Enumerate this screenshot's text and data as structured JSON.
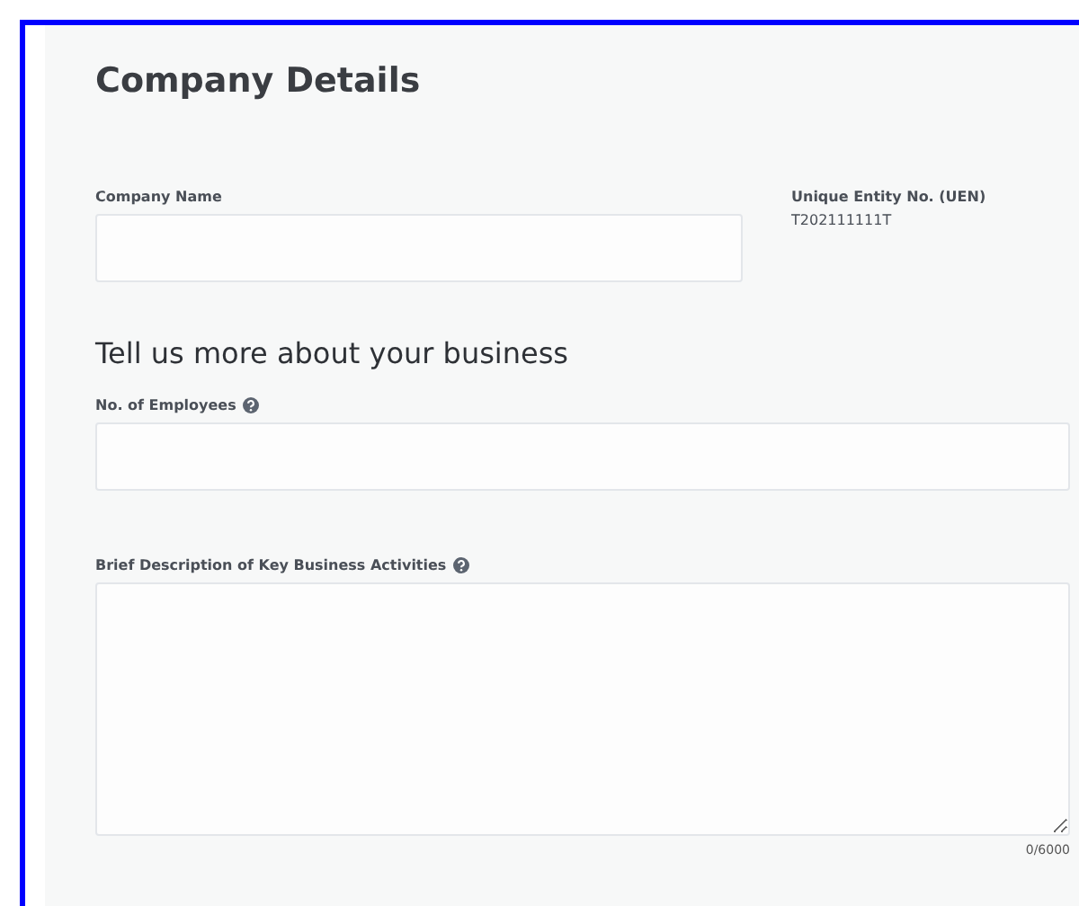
{
  "title": "Company Details",
  "company_name": {
    "label": "Company Name",
    "has_help": false
  },
  "uen": {
    "label": "Unique Entity No. (UEN)",
    "value": "T202111111T"
  },
  "section_heading": "Tell us more about your business",
  "employees": {
    "label": "No. of Employees",
    "has_help": true
  },
  "description": {
    "label": "Brief Description of Key Business Activities",
    "has_help": true,
    "counter": "0/6000"
  }
}
